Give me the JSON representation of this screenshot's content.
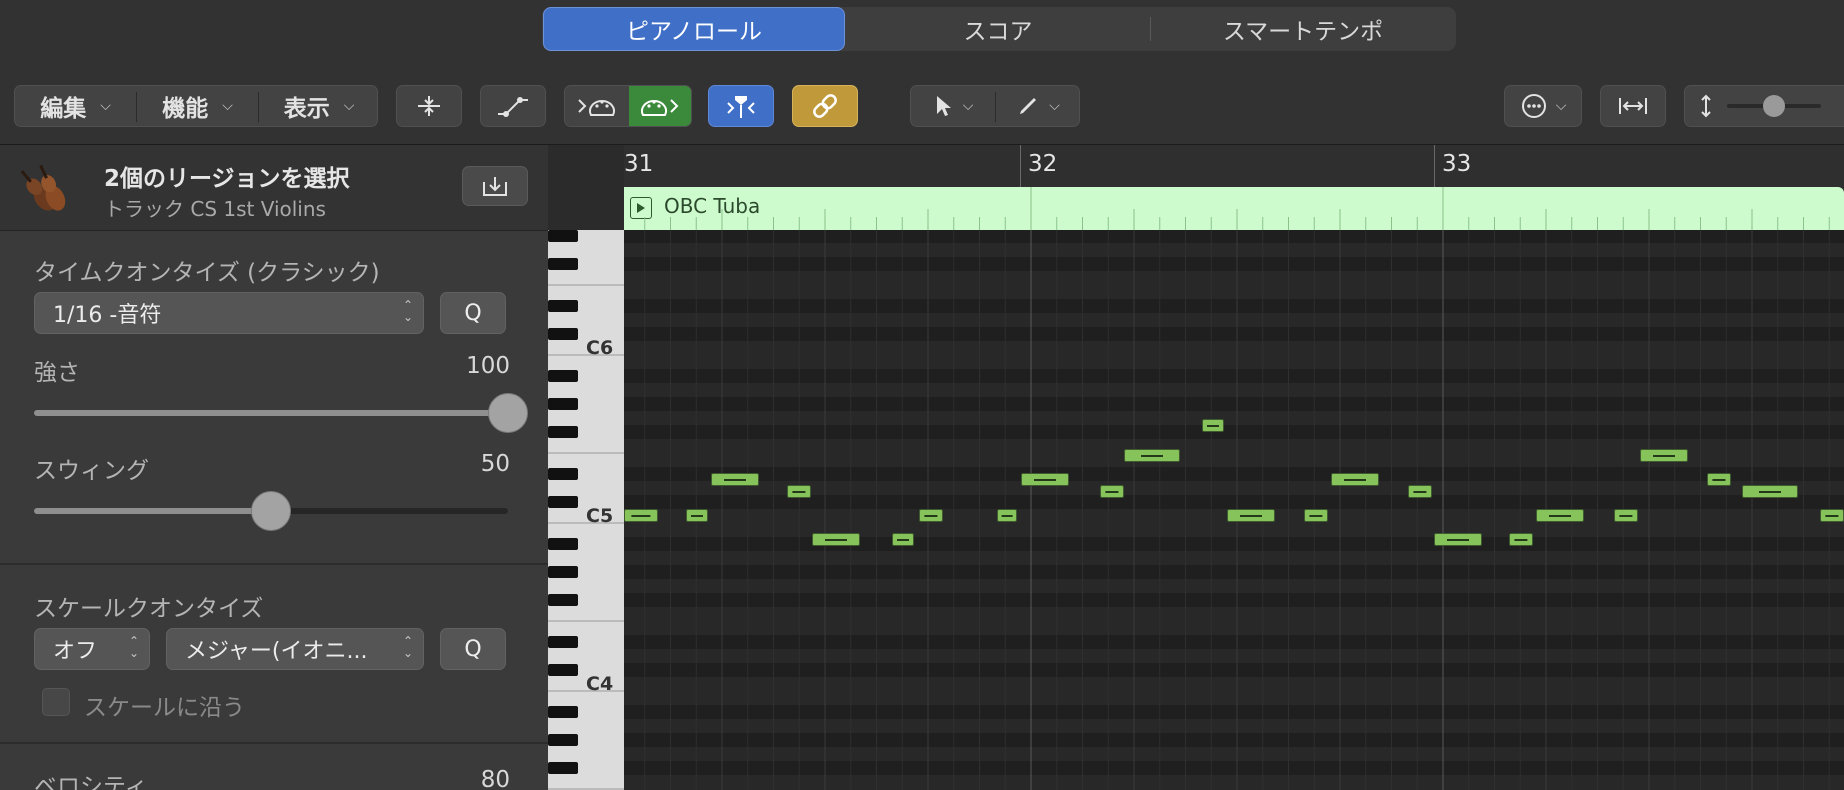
{
  "view_tabs": [
    {
      "label": "ピアノロール",
      "active": true
    },
    {
      "label": "スコア",
      "active": false
    },
    {
      "label": "スマートテンポ",
      "active": false
    }
  ],
  "toolbar": {
    "menus": [
      "編集",
      "機能",
      "表示"
    ],
    "accent_blue": "#3f6fc7",
    "accent_green": "#3b8a3b",
    "accent_gold": "#c09a3a"
  },
  "inspector": {
    "region_title": "2個のリージョンを選択",
    "track_subtitle": "トラック CS 1st Violins",
    "time_quantize": {
      "heading": "タイムクオンタイズ (クラシック)",
      "value": "1/16 -音符",
      "q_label": "Q"
    },
    "strength": {
      "label": "強さ",
      "value": "100",
      "level": 1.0
    },
    "swing": {
      "label": "スウィング",
      "value": "50",
      "level": 0.5
    },
    "scale_quantize": {
      "heading": "スケールクオンタイズ",
      "mode": "オフ",
      "scale": "メジャー(イオニ...",
      "q_label": "Q",
      "checkbox_label": "スケールに沿う"
    },
    "velocity": {
      "label": "ベロシティ",
      "value": "80"
    }
  },
  "keyboard": {
    "labels": [
      "C6",
      "C5",
      "C4"
    ]
  },
  "ruler": {
    "bars": [
      "31",
      "32",
      "33"
    ]
  },
  "region": {
    "name": "OBC Tuba",
    "color": "#cdfbcd"
  }
}
